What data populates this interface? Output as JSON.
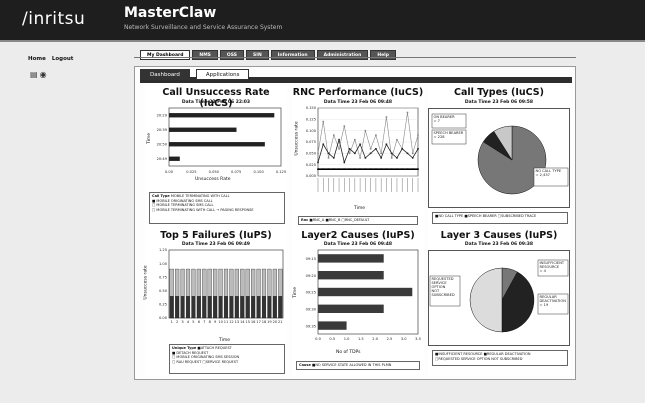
{
  "header": {
    "logo": "/inritsu",
    "title": "MasterClaw",
    "subtitle": "Network Surveillance and Service Assurance System"
  },
  "side": {
    "home": "Home",
    "logout": "Logout",
    "icons": [
      "document-icon",
      "camera-icon"
    ]
  },
  "top_tabs": [
    "My Dashboard",
    "NMS",
    "OSS",
    "SIN",
    "Information",
    "Administration",
    "Help"
  ],
  "sub_tabs": [
    "Dashboard",
    "Applications"
  ],
  "charts": {
    "unsuccess": {
      "title": "Call Unsuccess Rate (IuCS)",
      "time": "Data Time 22 Feb 06 22:03",
      "xlabel": "Unsuccess Rate",
      "ylabel": "Time",
      "legend_title": "Call Type",
      "legend_items": [
        "MOBILE TERMINATING WITH CALL",
        "MOBILE ORIGINATING SMS CALL",
        "MOBILE TERMINATING SMS CALL",
        "MOBILE TERMINATING WITH CALL → PAGING RESPONSE"
      ]
    },
    "rnc": {
      "title": "RNC Performance (IuCS)",
      "time": "Data Time 23 Feb 06 09:48",
      "xlabel": "Time",
      "ylabel": "Unsuccess rate",
      "legend_title": "Rnc",
      "legend_items": [
        "RNC_A",
        "RNC_B",
        "RNC_DEFAULT"
      ]
    },
    "calltypes": {
      "title": "Call Types (IuCS)",
      "time": "Data Time 23 Feb 06 09:58",
      "legend_items": [
        "NO CALL TYPE",
        "SPEECH BEARER",
        "SUBSCRIBED TRACE"
      ]
    },
    "failures": {
      "title": "Top 5 FailureS (IuPS)",
      "time": "Data Time 23 Feb 06 09:49",
      "xlabel": "Time",
      "ylabel": "Unsuccess rate",
      "legend_title": "Unique Type",
      "legend_items": [
        "ATTACH REQUEST",
        "DETACH REQUEST",
        "MOBILE ORIGINATING SMS SESSION",
        "RAU REQUEST",
        "SERVICE REQUEST"
      ]
    },
    "layer2": {
      "title": "Layer2 Causes (IuPS)",
      "time": "Data Time 23 Feb 06 09:48",
      "xlabel": "No of TDPs",
      "ylabel": "Time",
      "legend_title": "Cause",
      "legend_items": [
        "NO SERVICE STATE ALLOWED IN THIS PLMN"
      ]
    },
    "layer3": {
      "title": "Layer 3 Causes (IuPS)",
      "time": "Data Time 23 Feb 06 09:38",
      "legend_items": [
        "INSUFFICIENT RESOURCE",
        "REGULAR DEACTIVATION",
        "REQUESTED SERVICE OPTION NOT SUBSCRIBED"
      ]
    }
  },
  "chart_data": [
    {
      "type": "bar",
      "title": "Call Unsuccess Rate (IuCS)",
      "xlabel": "Unsuccess Rate",
      "ylabel": "Time",
      "categories": [
        "20:29",
        "20:39",
        "20:50",
        "20:49"
      ],
      "values": [
        0.078,
        0.05,
        0.071,
        0.008
      ],
      "xlim": [
        0,
        0.08
      ],
      "x_ticks": [
        "0.00",
        "0.025",
        "0.050",
        "0.075",
        "0.100",
        "0.125"
      ]
    },
    {
      "type": "line",
      "title": "RNC Performance (IuCS)",
      "xlabel": "Time",
      "ylabel": "Unsuccess rate",
      "y_ticks": [
        "0.150",
        "0.125",
        "0.100",
        "0.075",
        "0.050",
        "0.025",
        "0.000"
      ],
      "ylim": [
        0,
        0.15
      ],
      "series": [
        {
          "name": "RNC_A",
          "values": [
            0.05,
            0.12,
            0.04,
            0.09,
            0.06,
            0.11,
            0.05,
            0.08,
            0.04,
            0.1,
            0.06,
            0.09,
            0.05,
            0.13,
            0.04,
            0.08,
            0.06,
            0.14,
            0.05,
            0.09
          ]
        },
        {
          "name": "RNC_B",
          "values": [
            0.03,
            0.07,
            0.05,
            0.04,
            0.08,
            0.03,
            0.06,
            0.05,
            0.07,
            0.04,
            0.05,
            0.06,
            0.04,
            0.07,
            0.05,
            0.04,
            0.06,
            0.05,
            0.04,
            0.06
          ]
        },
        {
          "name": "RNC_DEFAULT",
          "values": [
            0.015,
            0.015,
            0.015,
            0.015,
            0.015,
            0.015,
            0.015,
            0.015,
            0.015,
            0.015,
            0.015,
            0.015,
            0.015,
            0.015,
            0.015,
            0.015,
            0.015,
            0.015,
            0.015,
            0.015
          ]
        }
      ]
    },
    {
      "type": "pie",
      "title": "Call Types (IuCS)",
      "categories": [
        "NO CALL TYPE",
        "SPEECH BEARER",
        "SUBSCRIBED TRACE"
      ],
      "values": [
        84,
        7,
        9
      ],
      "labels": [
        "NO CALL TYPE = 2,437",
        "ON BEARER = 7",
        "SPEECH BEARER = 228"
      ]
    },
    {
      "type": "bar",
      "title": "Top 5 FailureS (IuPS)",
      "xlabel": "Time",
      "ylabel": "Unsuccess rate",
      "categories": [
        "1",
        "2",
        "3",
        "4",
        "5",
        "6",
        "7",
        "8",
        "9",
        "10",
        "11",
        "12",
        "13",
        "14",
        "15",
        "16",
        "17",
        "18",
        "19",
        "20",
        "21"
      ],
      "series": [
        {
          "name": "ATTACH REQUEST",
          "values": [
            0.4,
            0.4,
            0.4,
            0.4,
            0.4,
            0.4,
            0.4,
            0.4,
            0.4,
            0.4,
            0.4,
            0.4,
            0.4,
            0.4,
            0.4,
            0.4,
            0.4,
            0.4,
            0.4,
            0.4,
            0.4
          ]
        },
        {
          "name": "SERVICE REQUEST",
          "values": [
            0.5,
            0.5,
            0.5,
            0.5,
            0.5,
            0.5,
            0.5,
            0.5,
            0.5,
            0.5,
            0.5,
            0.5,
            0.5,
            0.5,
            0.5,
            0.5,
            0.5,
            0.5,
            0.5,
            0.5,
            0.5
          ]
        }
      ],
      "ylim": [
        0,
        1.25
      ],
      "y_ticks": [
        "1.25",
        "1.00",
        "0.75",
        "0.50",
        "0.25",
        "0.00"
      ]
    },
    {
      "type": "bar",
      "title": "Layer2 Causes (IuPS)",
      "xlabel": "No of TDPs",
      "ylabel": "Time",
      "categories": [
        "09:15",
        "09:20",
        "09:25",
        "09:30",
        "09:35"
      ],
      "values": [
        2.3,
        2.3,
        3.3,
        2.3,
        1.0
      ],
      "xlim": [
        0,
        3.5
      ],
      "x_ticks": [
        "0.0",
        "0.5",
        "1.0",
        "1.5",
        "2.0",
        "2.5",
        "3.0",
        "3.5"
      ]
    },
    {
      "type": "pie",
      "title": "Layer 3 Causes (IuPS)",
      "categories": [
        "INSUFFICIENT RESOURCE",
        "REGULAR DEACTIVATION",
        "REQUESTED SERVICE OPTION NOT SUBSCRIBED"
      ],
      "values": [
        8,
        42,
        50
      ],
      "labels": [
        "INSUFFICIENT RESOURCE = 4",
        "REGULAR DEACTIVATION = 19",
        "REQUESTED SERVICE OPTION NOT SUBSCRIBED = 23"
      ]
    }
  ]
}
